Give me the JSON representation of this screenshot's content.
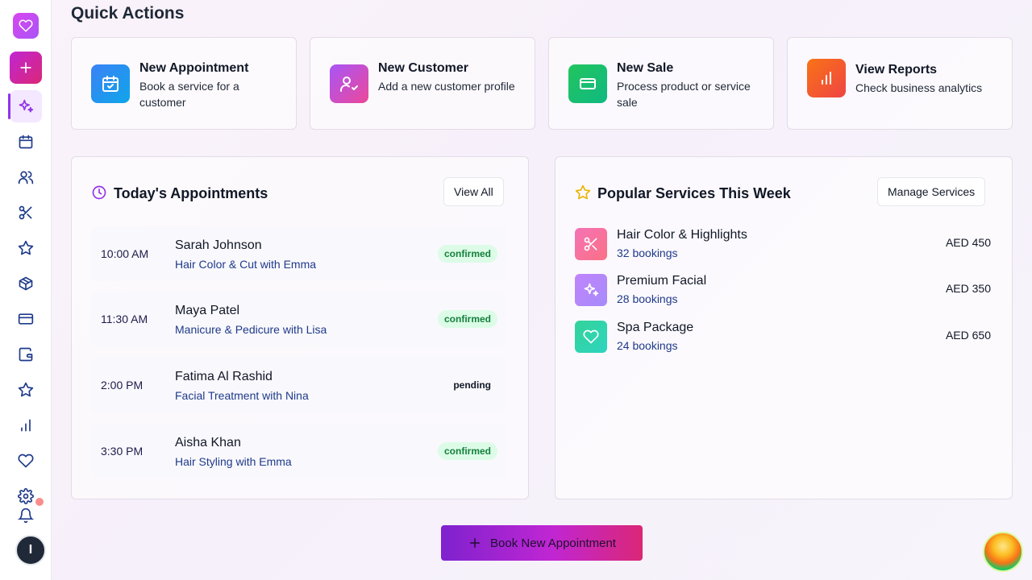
{
  "page_title": "Quick Actions",
  "quick_actions": [
    {
      "title": "New Appointment",
      "desc": "Book a service for a customer",
      "icon": "calendar-check-icon",
      "color": "#2196f3"
    },
    {
      "title": "New Customer",
      "desc": "Add a new customer profile",
      "icon": "user-check-icon",
      "color": "#c026d3"
    },
    {
      "title": "New Sale",
      "desc": "Process product or service sale",
      "icon": "credit-card-icon",
      "color": "#16a34a"
    },
    {
      "title": "View Reports",
      "desc": "Check business analytics",
      "icon": "bar-chart-icon",
      "color": "#f97316"
    }
  ],
  "appointments": {
    "title": "Today's Appointments",
    "view_all": "View All",
    "items": [
      {
        "time": "10:00 AM",
        "name": "Sarah Johnson",
        "service": "Hair Color & Cut with Emma",
        "status": "confirmed"
      },
      {
        "time": "11:30 AM",
        "name": "Maya Patel",
        "service": "Manicure & Pedicure with Lisa",
        "status": "confirmed"
      },
      {
        "time": "2:00 PM",
        "name": "Fatima Al Rashid",
        "service": "Facial Treatment with Nina",
        "status": "pending"
      },
      {
        "time": "3:30 PM",
        "name": "Aisha Khan",
        "service": "Hair Styling with Emma",
        "status": "confirmed"
      }
    ]
  },
  "services": {
    "title": "Popular Services This Week",
    "manage": "Manage Services",
    "items": [
      {
        "name": "Hair Color & Highlights",
        "count": "32 bookings",
        "price": "AED 450",
        "icon": "scissors-icon",
        "color": "#f472b6"
      },
      {
        "name": "Premium Facial",
        "count": "28 bookings",
        "price": "AED 350",
        "icon": "sparkles-icon",
        "color": "#c084fc"
      },
      {
        "name": "Spa Package",
        "count": "24 bookings",
        "price": "AED 650",
        "icon": "heart-icon",
        "color": "#2dd4bf"
      }
    ]
  },
  "book_button": "Book New Appointment",
  "sidebar": {
    "items": [
      "heart-logo-icon",
      "plus-icon",
      "sparkles-icon",
      "calendar-icon",
      "users-icon",
      "scissors-icon",
      "star-icon",
      "package-icon",
      "credit-card-icon",
      "wallet-icon",
      "star-icon",
      "bar-chart-icon",
      "heart-icon",
      "gear-icon",
      "bell-icon"
    ],
    "user_initial": "I"
  }
}
